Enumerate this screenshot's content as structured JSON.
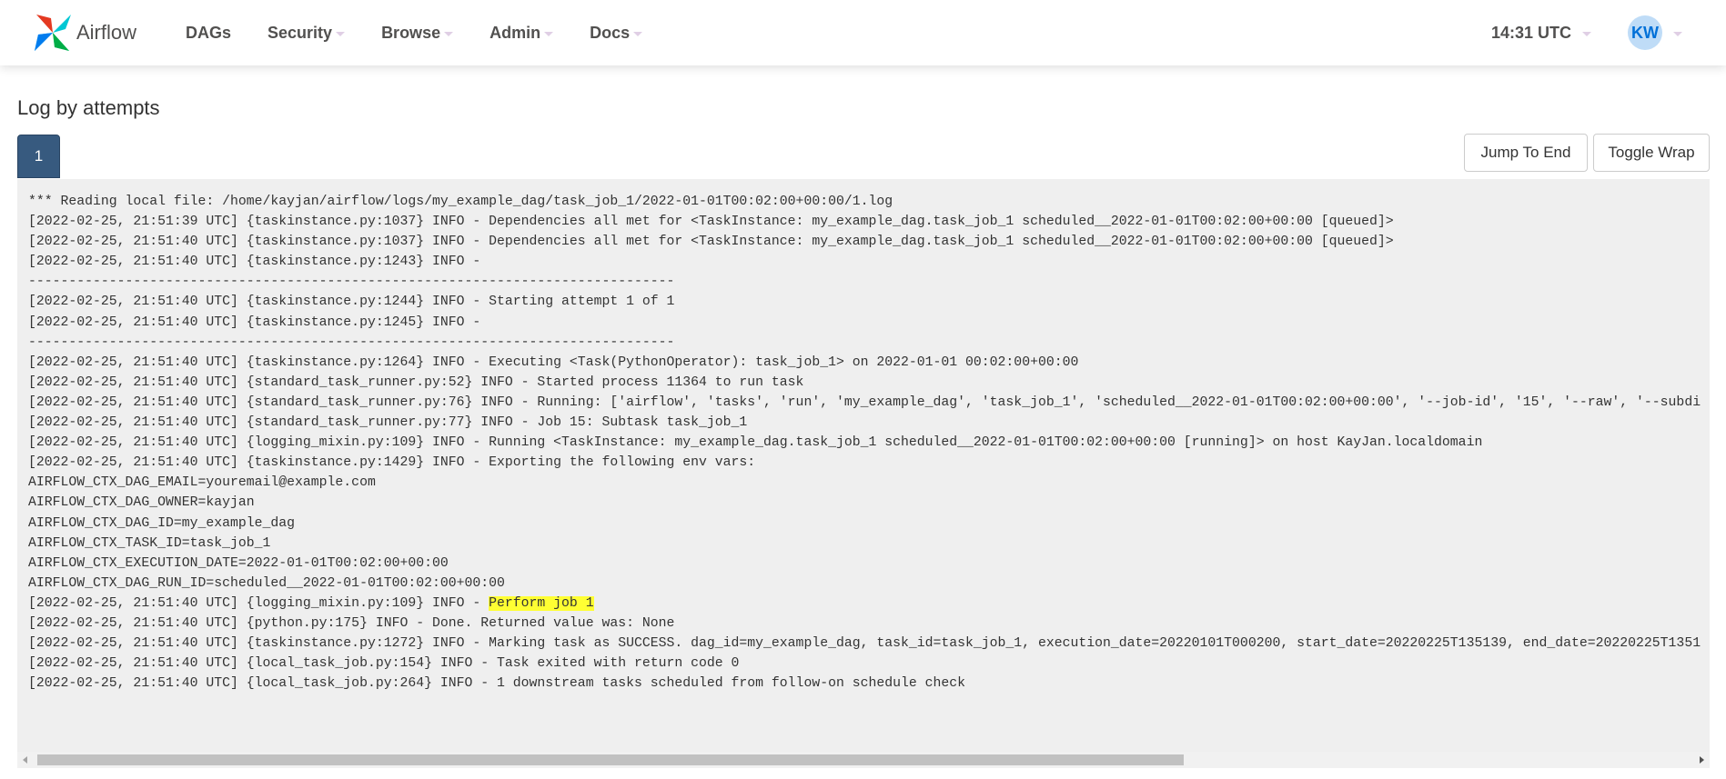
{
  "nav": {
    "brand": "Airflow",
    "items": [
      {
        "label": "DAGs",
        "caret": false
      },
      {
        "label": "Security",
        "caret": true
      },
      {
        "label": "Browse",
        "caret": true
      },
      {
        "label": "Admin",
        "caret": true
      },
      {
        "label": "Docs",
        "caret": true
      }
    ],
    "time": "14:31 UTC",
    "user_initials": "KW"
  },
  "page": {
    "title": "Log by attempts",
    "attempt": "1",
    "jump_to_end": "Jump To End",
    "toggle_wrap": "Toggle Wrap"
  },
  "log": {
    "lines": [
      "*** Reading local file: /home/kayjan/airflow/logs/my_example_dag/task_job_1/2022-01-01T00:02:00+00:00/1.log",
      "[2022-02-25, 21:51:39 UTC] {taskinstance.py:1037} INFO - Dependencies all met for <TaskInstance: my_example_dag.task_job_1 scheduled__2022-01-01T00:02:00+00:00 [queued]>",
      "[2022-02-25, 21:51:40 UTC] {taskinstance.py:1037} INFO - Dependencies all met for <TaskInstance: my_example_dag.task_job_1 scheduled__2022-01-01T00:02:00+00:00 [queued]>",
      "[2022-02-25, 21:51:40 UTC] {taskinstance.py:1243} INFO - ",
      "--------------------------------------------------------------------------------",
      "[2022-02-25, 21:51:40 UTC] {taskinstance.py:1244} INFO - Starting attempt 1 of 1",
      "[2022-02-25, 21:51:40 UTC] {taskinstance.py:1245} INFO - ",
      "--------------------------------------------------------------------------------",
      "[2022-02-25, 21:51:40 UTC] {taskinstance.py:1264} INFO - Executing <Task(PythonOperator): task_job_1> on 2022-01-01 00:02:00+00:00",
      "[2022-02-25, 21:51:40 UTC] {standard_task_runner.py:52} INFO - Started process 11364 to run task",
      "[2022-02-25, 21:51:40 UTC] {standard_task_runner.py:76} INFO - Running: ['airflow', 'tasks', 'run', 'my_example_dag', 'task_job_1', 'scheduled__2022-01-01T00:02:00+00:00', '--job-id', '15', '--raw', '--subdi",
      "[2022-02-25, 21:51:40 UTC] {standard_task_runner.py:77} INFO - Job 15: Subtask task_job_1",
      "[2022-02-25, 21:51:40 UTC] {logging_mixin.py:109} INFO - Running <TaskInstance: my_example_dag.task_job_1 scheduled__2022-01-01T00:02:00+00:00 [running]> on host KayJan.localdomain",
      "[2022-02-25, 21:51:40 UTC] {taskinstance.py:1429} INFO - Exporting the following env vars:",
      "AIRFLOW_CTX_DAG_EMAIL=youremail@example.com",
      "AIRFLOW_CTX_DAG_OWNER=kayjan",
      "AIRFLOW_CTX_DAG_ID=my_example_dag",
      "AIRFLOW_CTX_TASK_ID=task_job_1",
      "AIRFLOW_CTX_EXECUTION_DATE=2022-01-01T00:02:00+00:00",
      "AIRFLOW_CTX_DAG_RUN_ID=scheduled__2022-01-01T00:02:00+00:00"
    ],
    "highlight_prefix": "[2022-02-25, 21:51:40 UTC] {logging_mixin.py:109} INFO - ",
    "highlight_text": "Perform job 1",
    "lines_after": [
      "[2022-02-25, 21:51:40 UTC] {python.py:175} INFO - Done. Returned value was: None",
      "[2022-02-25, 21:51:40 UTC] {taskinstance.py:1272} INFO - Marking task as SUCCESS. dag_id=my_example_dag, task_id=task_job_1, execution_date=20220101T000200, start_date=20220225T135139, end_date=20220225T1351",
      "[2022-02-25, 21:51:40 UTC] {local_task_job.py:154} INFO - Task exited with return code 0",
      "[2022-02-25, 21:51:40 UTC] {local_task_job.py:264} INFO - 1 downstream tasks scheduled from follow-on schedule check"
    ],
    "highlight_color": "#ffff33"
  }
}
